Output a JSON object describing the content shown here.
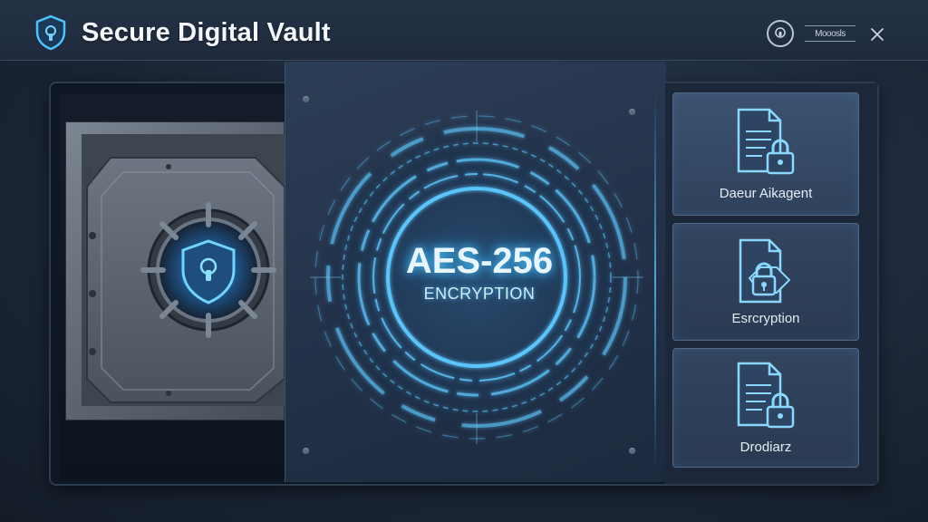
{
  "app": {
    "title": "Secure Digital Vault",
    "settings_label": "Mooosls"
  },
  "center": {
    "title": "AES-256",
    "subtitle": "ENCRYPTION"
  },
  "cards": [
    {
      "label": "Daeur Aikagent",
      "icon": "document-lock-icon"
    },
    {
      "label": "Esrcryption",
      "icon": "file-lock-icon"
    },
    {
      "label": "Drodiarz",
      "icon": "document-lock-icon"
    }
  ],
  "colors": {
    "accent": "#4cc4ff",
    "background": "#1c2738",
    "header": "#243246"
  }
}
